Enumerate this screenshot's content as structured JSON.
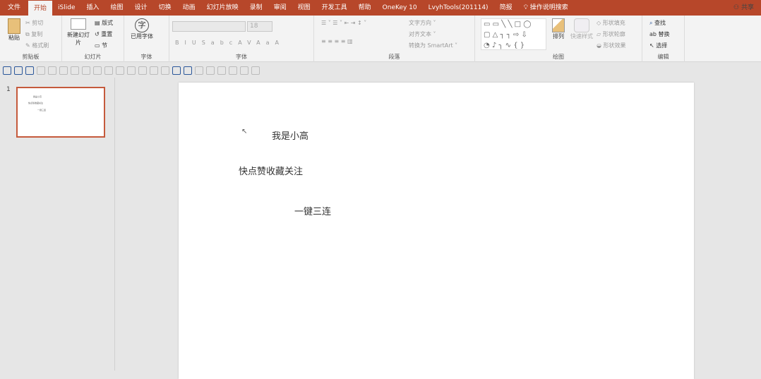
{
  "tabs": [
    "文件",
    "开始",
    "iSlide",
    "插入",
    "绘图",
    "设计",
    "切换",
    "动画",
    "幻灯片放映",
    "录制",
    "审阅",
    "视图",
    "开发工具",
    "帮助",
    "OneKey 10",
    "LvyhTools(201114)",
    "简报"
  ],
  "active_tab": "开始",
  "search": "操作说明搜索",
  "share": "共享",
  "ribbon": {
    "clipboard": {
      "label": "剪贴板",
      "paste": "粘贴",
      "cut": "剪切",
      "copy": "复制",
      "format_painter": "格式刷"
    },
    "slides": {
      "label": "幻灯片",
      "new_slide": "新建幻灯片",
      "layout": "版式",
      "reset": "重置",
      "section": "节"
    },
    "font_group": {
      "label": "字体",
      "used_fonts": "已用字体"
    },
    "font": {
      "label": "字体",
      "size": "18",
      "bold": "B",
      "italic": "I",
      "underline": "U",
      "strike": "S",
      "abc": "abc",
      "spacing": "AV",
      "case": "Aa",
      "color": "A"
    },
    "paragraph": {
      "label": "段落",
      "text_direction": "文字方向",
      "align_text": "对齐文本",
      "smartart": "转换为 SmartArt"
    },
    "drawing": {
      "label": "绘图",
      "arrange": "排列",
      "quick_styles": "快速样式",
      "fill": "形状填充",
      "outline": "形状轮廓",
      "effects": "形状效果"
    },
    "editing": {
      "label": "编辑",
      "find": "查找",
      "replace": "替换",
      "select": "选择"
    }
  },
  "slide_number": "1",
  "slide": {
    "texts": [
      "我是小高",
      "快点赞收藏关注",
      "一键三连"
    ]
  },
  "colors": {
    "accent": "#b7472a"
  }
}
